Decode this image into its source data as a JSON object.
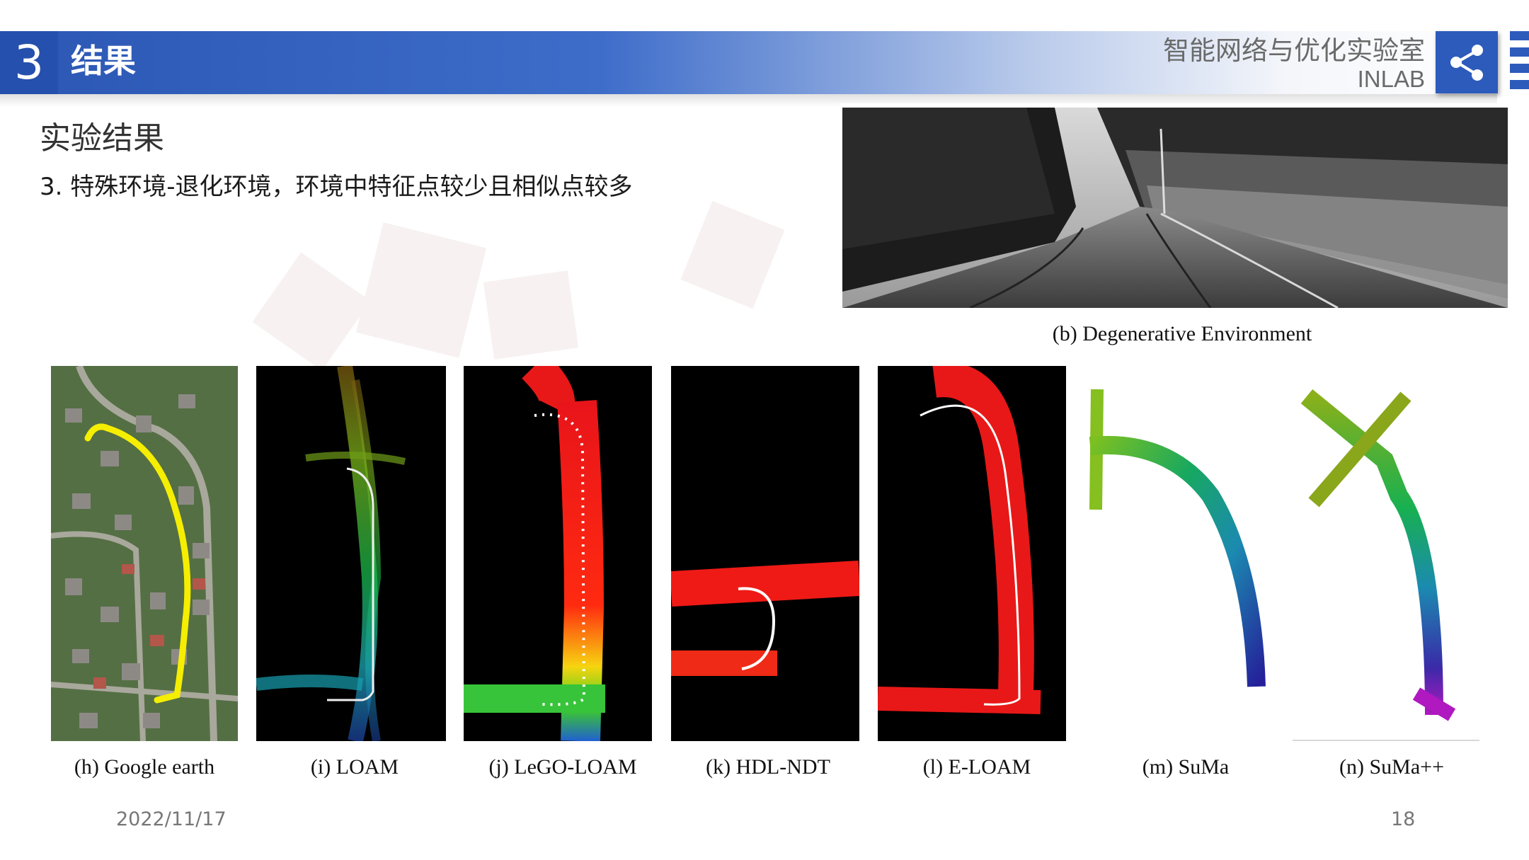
{
  "header": {
    "section_number": "3",
    "section_title": "结果",
    "lab_name": "智能网络与优化实验室",
    "lab_abbr": "INLAB",
    "accent_color": "#2c57b4"
  },
  "icons": {
    "share": "share-icon",
    "menu": "menu-icon"
  },
  "content": {
    "title": "实验结果",
    "subtitle": "3. 特殊环境-退化环境，环境中特征点较少且相似点较多"
  },
  "figure_b": {
    "caption": "(b)  Degenerative  Environment"
  },
  "panels": [
    {
      "id": "h",
      "caption": "(h)  Google  earth"
    },
    {
      "id": "i",
      "caption": "(i)  LOAM"
    },
    {
      "id": "j",
      "caption": "(j)  LeGO-LOAM"
    },
    {
      "id": "k",
      "caption": "(k)  HDL-NDT"
    },
    {
      "id": "l",
      "caption": "(l)  E-LOAM"
    },
    {
      "id": "m",
      "caption": "(m)  SuMa"
    },
    {
      "id": "n",
      "caption": "(n)  SuMa++"
    }
  ],
  "footer": {
    "date": "2022/11/17",
    "page_number": "18"
  }
}
